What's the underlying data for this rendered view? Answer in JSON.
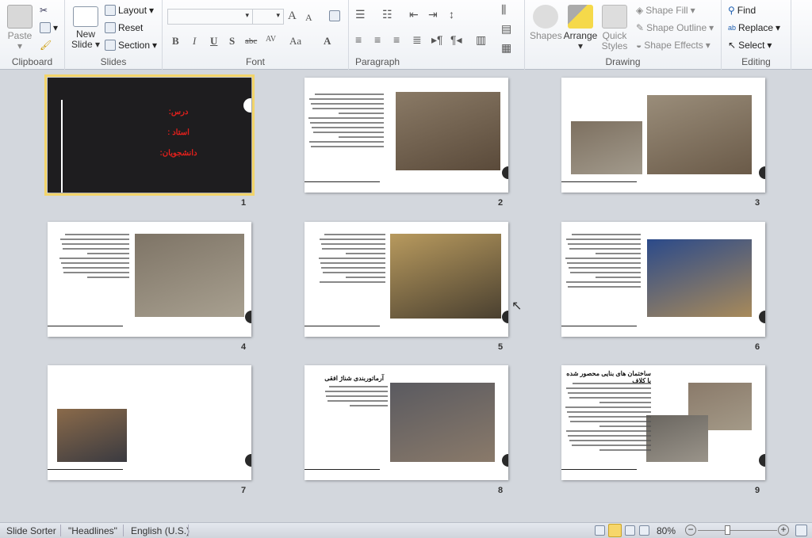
{
  "ribbon": {
    "clipboard": {
      "label": "Clipboard",
      "paste": "Paste"
    },
    "slides": {
      "label": "Slides",
      "new_slide": "New Slide",
      "layout": "Layout",
      "reset": "Reset",
      "section": "Section"
    },
    "font": {
      "label": "Font",
      "font_name": "",
      "font_size": "",
      "bold": "B",
      "italic": "I",
      "underline": "U",
      "shadow": "S",
      "strike": "abc",
      "spacing": "AV",
      "case": "Aa",
      "color": "A",
      "grow": "A",
      "shrink": "A"
    },
    "paragraph": {
      "label": "Paragraph"
    },
    "drawing": {
      "label": "Drawing",
      "shapes": "Shapes",
      "arrange": "Arrange",
      "quick_styles": "Quick Styles",
      "shape_fill": "Shape Fill",
      "shape_outline": "Shape Outline",
      "shape_effects": "Shape Effects"
    },
    "editing": {
      "label": "Editing",
      "find": "Find",
      "replace": "Replace",
      "select": "Select"
    }
  },
  "slides": [
    {
      "number": "1",
      "selected": true,
      "lines": [
        "درس:",
        "استاد :",
        "دانشجویان:"
      ],
      "text_color": "#e0201c"
    },
    {
      "number": "2"
    },
    {
      "number": "3"
    },
    {
      "number": "4"
    },
    {
      "number": "5"
    },
    {
      "number": "6"
    },
    {
      "number": "7"
    },
    {
      "number": "8",
      "title": "آرماتوربندی شناژ افقی"
    },
    {
      "number": "9",
      "title": "ساختمان های بنایی محصور شده با کلاف"
    }
  ],
  "status": {
    "view": "Slide Sorter",
    "theme": "\"Headlines\"",
    "language": "English (U.S.)",
    "zoom": "80%"
  },
  "colors": {
    "selection": "#f2d46a",
    "title_slide_bg": "#1e1d1f"
  }
}
